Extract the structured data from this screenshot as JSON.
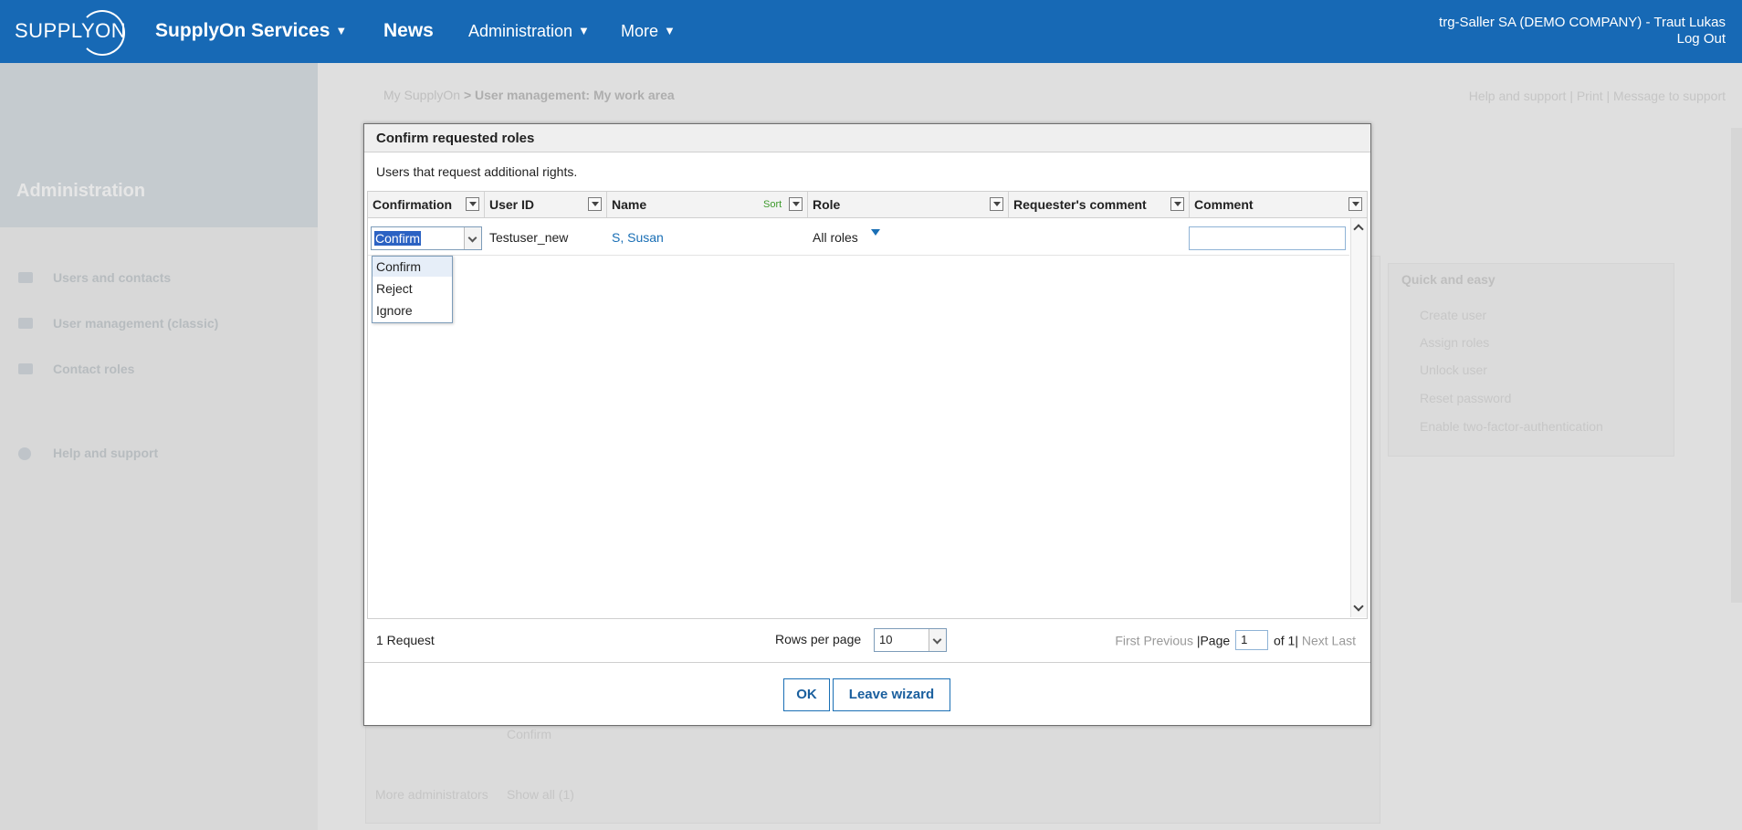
{
  "topbar": {
    "logo": "SUPPLYON",
    "nav": [
      "SupplyOn Services",
      "News",
      "Administration",
      "More"
    ],
    "user": "trg-Saller SA (DEMO COMPANY) - Traut Lukas",
    "logout": "Log Out"
  },
  "sidebar": {
    "title": "Administration",
    "items": [
      "Users and contacts",
      "User management (classic)",
      "Contact roles",
      "Help and support"
    ]
  },
  "breadcrumb": {
    "root": "My SupplyOn",
    "sep": ">",
    "current": "User management: My work area"
  },
  "help_links": "Help and support | Print | Message to support",
  "quick": {
    "title": "Quick and easy",
    "items": [
      "Create user",
      "Assign roles",
      "Unlock user",
      "Reset password",
      "Enable two-factor-authentication"
    ]
  },
  "background": {
    "confirm": "Confirm",
    "more_admins": "More administrators",
    "show_all": "Show all (1)"
  },
  "dialog": {
    "title": "Confirm requested roles",
    "subtitle": "Users that request additional rights.",
    "columns": [
      "Confirmation",
      "User ID",
      "Name",
      "Role",
      "Requester's comment",
      "Comment"
    ],
    "sort_label": "Sort",
    "rows": [
      {
        "confirmation": "Confirm",
        "user_id": "Testuser_new",
        "name": "S, Susan",
        "role": "All roles",
        "requester_comment": "",
        "comment": ""
      }
    ],
    "dropdown_options": [
      "Confirm",
      "Reject",
      "Ignore"
    ],
    "count": "1 Request",
    "rows_per_page_label": "Rows per page",
    "rows_per_page": "10",
    "pager": {
      "first": "First",
      "previous": "Previous",
      "page": "Page",
      "page_value": "1",
      "of": "of 1",
      "next": "Next",
      "last": "Last"
    },
    "ok": "OK",
    "leave": "Leave wizard"
  }
}
